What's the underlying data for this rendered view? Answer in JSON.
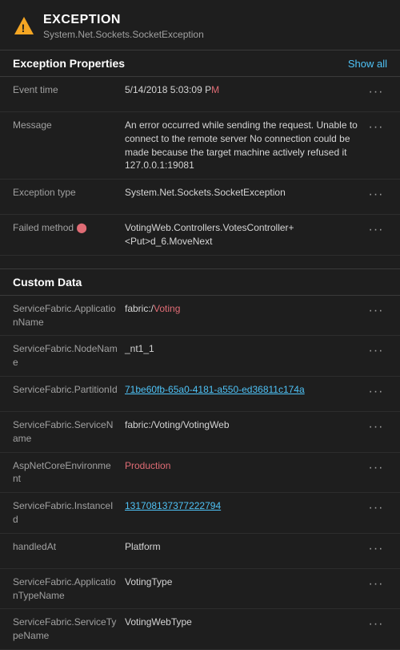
{
  "header": {
    "title": "EXCEPTION",
    "subtitle": "System.Net.Sockets.SocketException"
  },
  "exception_properties": {
    "section_label": "Exception Properties",
    "show_all": "Show all",
    "rows": [
      {
        "key": "Event time",
        "value_plain": "5/14/2018 5:03:09 P",
        "value_highlight": "M",
        "value_suffix": ""
      },
      {
        "key": "Message",
        "value_plain": "An error occurred while sending the request. Unable to connect to the remote server No connection could be made because the target machine actively refused it 127.0.0.1:19081",
        "value_highlight": "",
        "value_suffix": ""
      },
      {
        "key": "Exception type",
        "value_plain": "System.Net.Sockets.SocketException",
        "value_highlight": "",
        "value_suffix": ""
      },
      {
        "key": "Failed method",
        "value_plain": "VotingWeb.Controllers.VotesController+<Put>d_6.MoveNext",
        "value_highlight": "",
        "value_suffix": ""
      }
    ]
  },
  "custom_data": {
    "section_label": "Custom Data",
    "rows": [
      {
        "key": "ServiceFabric.ApplicationName",
        "value_plain": "fabric:/Voting",
        "value_highlight": "",
        "link": true
      },
      {
        "key": "ServiceFabric.NodeName",
        "value_plain": "_nt1_1",
        "value_highlight": "",
        "link": false
      },
      {
        "key": "ServiceFabric.PartitionId",
        "value_plain": "71be60fb-65a0-4181-a550-ed36811c174a",
        "value_highlight": "",
        "link": true
      },
      {
        "key": "ServiceFabric.ServiceName",
        "value_plain": "fabric:/Voting/VotingWeb",
        "value_highlight": "",
        "link": false
      },
      {
        "key": "AspNetCoreEnvironment",
        "value_plain": "Production",
        "value_highlight": "",
        "link": false,
        "red": true
      },
      {
        "key": "ServiceFabric.InstanceId",
        "value_plain": "131708137377222794",
        "value_highlight": "",
        "link": true
      },
      {
        "key": "handledAt",
        "value_plain": "Platform",
        "value_highlight": "",
        "link": false
      },
      {
        "key": "ServiceFabric.ApplicationTypeName",
        "value_plain": "VotingType",
        "value_highlight": "",
        "link": false
      },
      {
        "key": "ServiceFabric.ServiceTypeName",
        "value_plain": "VotingWebType",
        "value_highlight": "",
        "link": false
      }
    ]
  },
  "icons": {
    "warning": "⚠",
    "dots": "···"
  }
}
